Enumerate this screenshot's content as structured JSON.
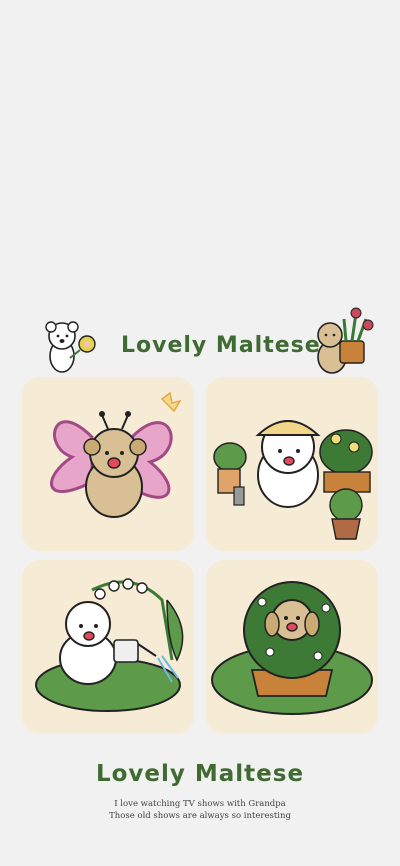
{
  "header": {
    "title": "Lovely Maltese"
  },
  "footer": {
    "title": "Lovely Maltese",
    "line1": "I love watching TV shows with Grandpa",
    "line2": "Those old shows are always so interesting"
  },
  "colors": {
    "card_bg": "#f6ebd4",
    "title_green": "#3f6b32",
    "background": "#f1f1f1"
  },
  "illustrations": [
    "puppy-butterfly-costume",
    "maltese-gardening-hat",
    "maltese-watering-can",
    "puppy-in-bush"
  ]
}
